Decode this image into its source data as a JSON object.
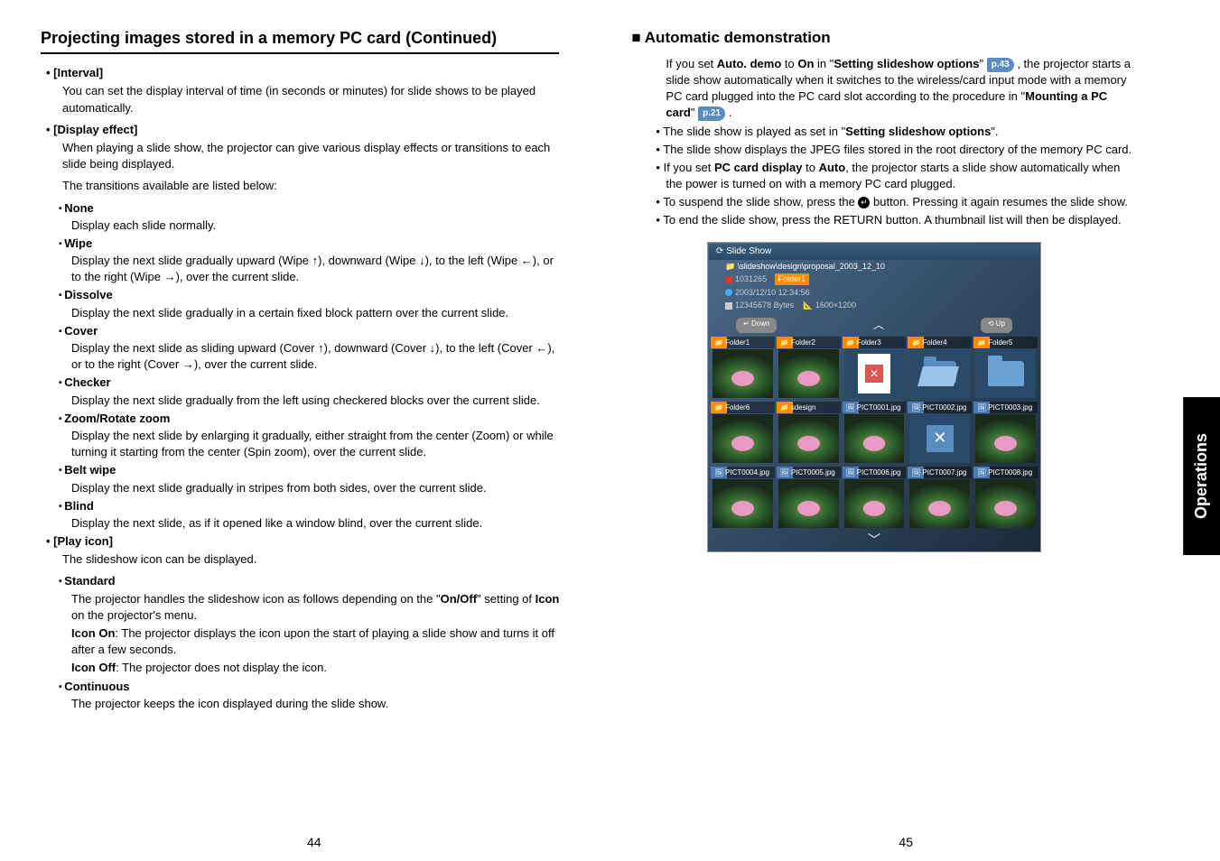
{
  "side_tab": "Operations",
  "page_numbers": {
    "left": "44",
    "right": "45"
  },
  "left": {
    "title": "Projecting images stored in a memory PC card (Continued)",
    "interval": {
      "heading": "[Interval]",
      "text": "You can set the display interval of time (in seconds or minutes) for slide shows to be played automatically."
    },
    "display_effect": {
      "heading": "[Display effect]",
      "intro1": "When playing a slide show, the projector can give various display effects or transitions to each slide being displayed.",
      "intro2": "The transitions available are listed below:",
      "items": [
        {
          "name": "None",
          "desc": "Display each slide normally."
        },
        {
          "name": "Wipe",
          "desc": "Display the next slide gradually upward (Wipe ↑), downward (Wipe ↓), to the left (Wipe ←), or to the right (Wipe →), over the current slide."
        },
        {
          "name": "Dissolve",
          "desc": "Display the next slide gradually in a certain fixed block pattern over the current slide."
        },
        {
          "name": "Cover",
          "desc": "Display the next slide as sliding upward (Cover ↑), downward (Cover ↓), to the left (Cover ←), or to the right (Cover →), over the current slide."
        },
        {
          "name": "Checker",
          "desc": "Display the next slide gradually from the left using checkered blocks over the current slide."
        },
        {
          "name": "Zoom/Rotate zoom",
          "desc": "Display the next slide by enlarging it gradually, either straight from the center (Zoom) or while turning it starting from the center (Spin zoom), over the current slide."
        },
        {
          "name": "Belt wipe",
          "desc": "Display the next slide gradually in stripes from both sides, over the current slide."
        },
        {
          "name": "Blind",
          "desc": "Display the next slide, as if it opened like a window blind, over the current slide."
        }
      ]
    },
    "play_icon": {
      "heading": "[Play icon]",
      "intro": "The slideshow icon can be displayed.",
      "standard": {
        "name": "Standard",
        "line1_pre": "The projector handles the slideshow icon as follows depending on the \"",
        "line1_bold": "On/Off",
        "line1_post": "\" setting of ",
        "line1_bold2": "Icon",
        "line1_post2": " on the projector's menu.",
        "icon_on_label": "Icon On",
        "icon_on_text": ":  The projector displays the icon upon the start of playing a slide show and turns it off after a few seconds.",
        "icon_off_label": "Icon Off",
        "icon_off_text": ":  The projector does not display the icon."
      },
      "continuous": {
        "name": "Continuous",
        "desc": "The projector keeps the icon displayed during the slide show."
      }
    }
  },
  "right": {
    "heading": "Automatic demonstration",
    "para1": {
      "t1": "If you set ",
      "b1": "Auto. demo",
      "t2": " to ",
      "b2": "On",
      "t3": " in \"",
      "b3": "Setting slideshow options",
      "t4": "\" ",
      "ref1": "p.43",
      "t5": " , the projector starts a slide show automatically when it switches to the wireless/card input mode with a memory PC card plugged into the PC card slot according to the procedure in \"",
      "b4": "Mounting a PC card",
      "t6": "\" ",
      "ref2": "p.21",
      "t7": " ."
    },
    "bullets": [
      {
        "pre": "The slide show is played as set in \"",
        "bold": "Setting slideshow options",
        "post": "\"."
      },
      {
        "text": "The slide show displays the JPEG files stored in the root directory of the memory PC card.",
        "justify": true
      },
      {
        "pre": "If you set ",
        "bold": "PC card display",
        "mid": " to ",
        "bold2": "Auto",
        "post": ", the projector starts a slide show automatically when the power is turned on with a memory PC card plugged."
      },
      {
        "pre": "To suspend the slide show, press the ",
        "icon": "↵",
        "post": " button. Pressing it again resumes the slide show."
      },
      {
        "text": "To end the slide show, press the RETURN button. A thumbnail list will then be displayed."
      }
    ],
    "screenshot": {
      "title": "Slide Show",
      "path": "\\slideshow\\design\\proposal_2003_12_10",
      "folder_tag": "Folder1",
      "date": "2003/12/10 12:34:56",
      "size": "12345678 Bytes",
      "res": "1600×1200",
      "btn_down": "Down",
      "btn_up": "Up",
      "labels": [
        "Folder1",
        "Folder2",
        "Folder3",
        "Folder4",
        "Folder5",
        "Folder6",
        "sdesign",
        "PICT0001.jpg",
        "PICT0002.jpg",
        "PICT0003.jpg",
        "PICT0004.jpg",
        "PICT0005.jpg",
        "PICT0006.jpg",
        "PICT0007.jpg",
        "PICT0008.jpg"
      ],
      "tag_size": "1031265"
    }
  },
  "icons": {
    "enter": "↵"
  }
}
